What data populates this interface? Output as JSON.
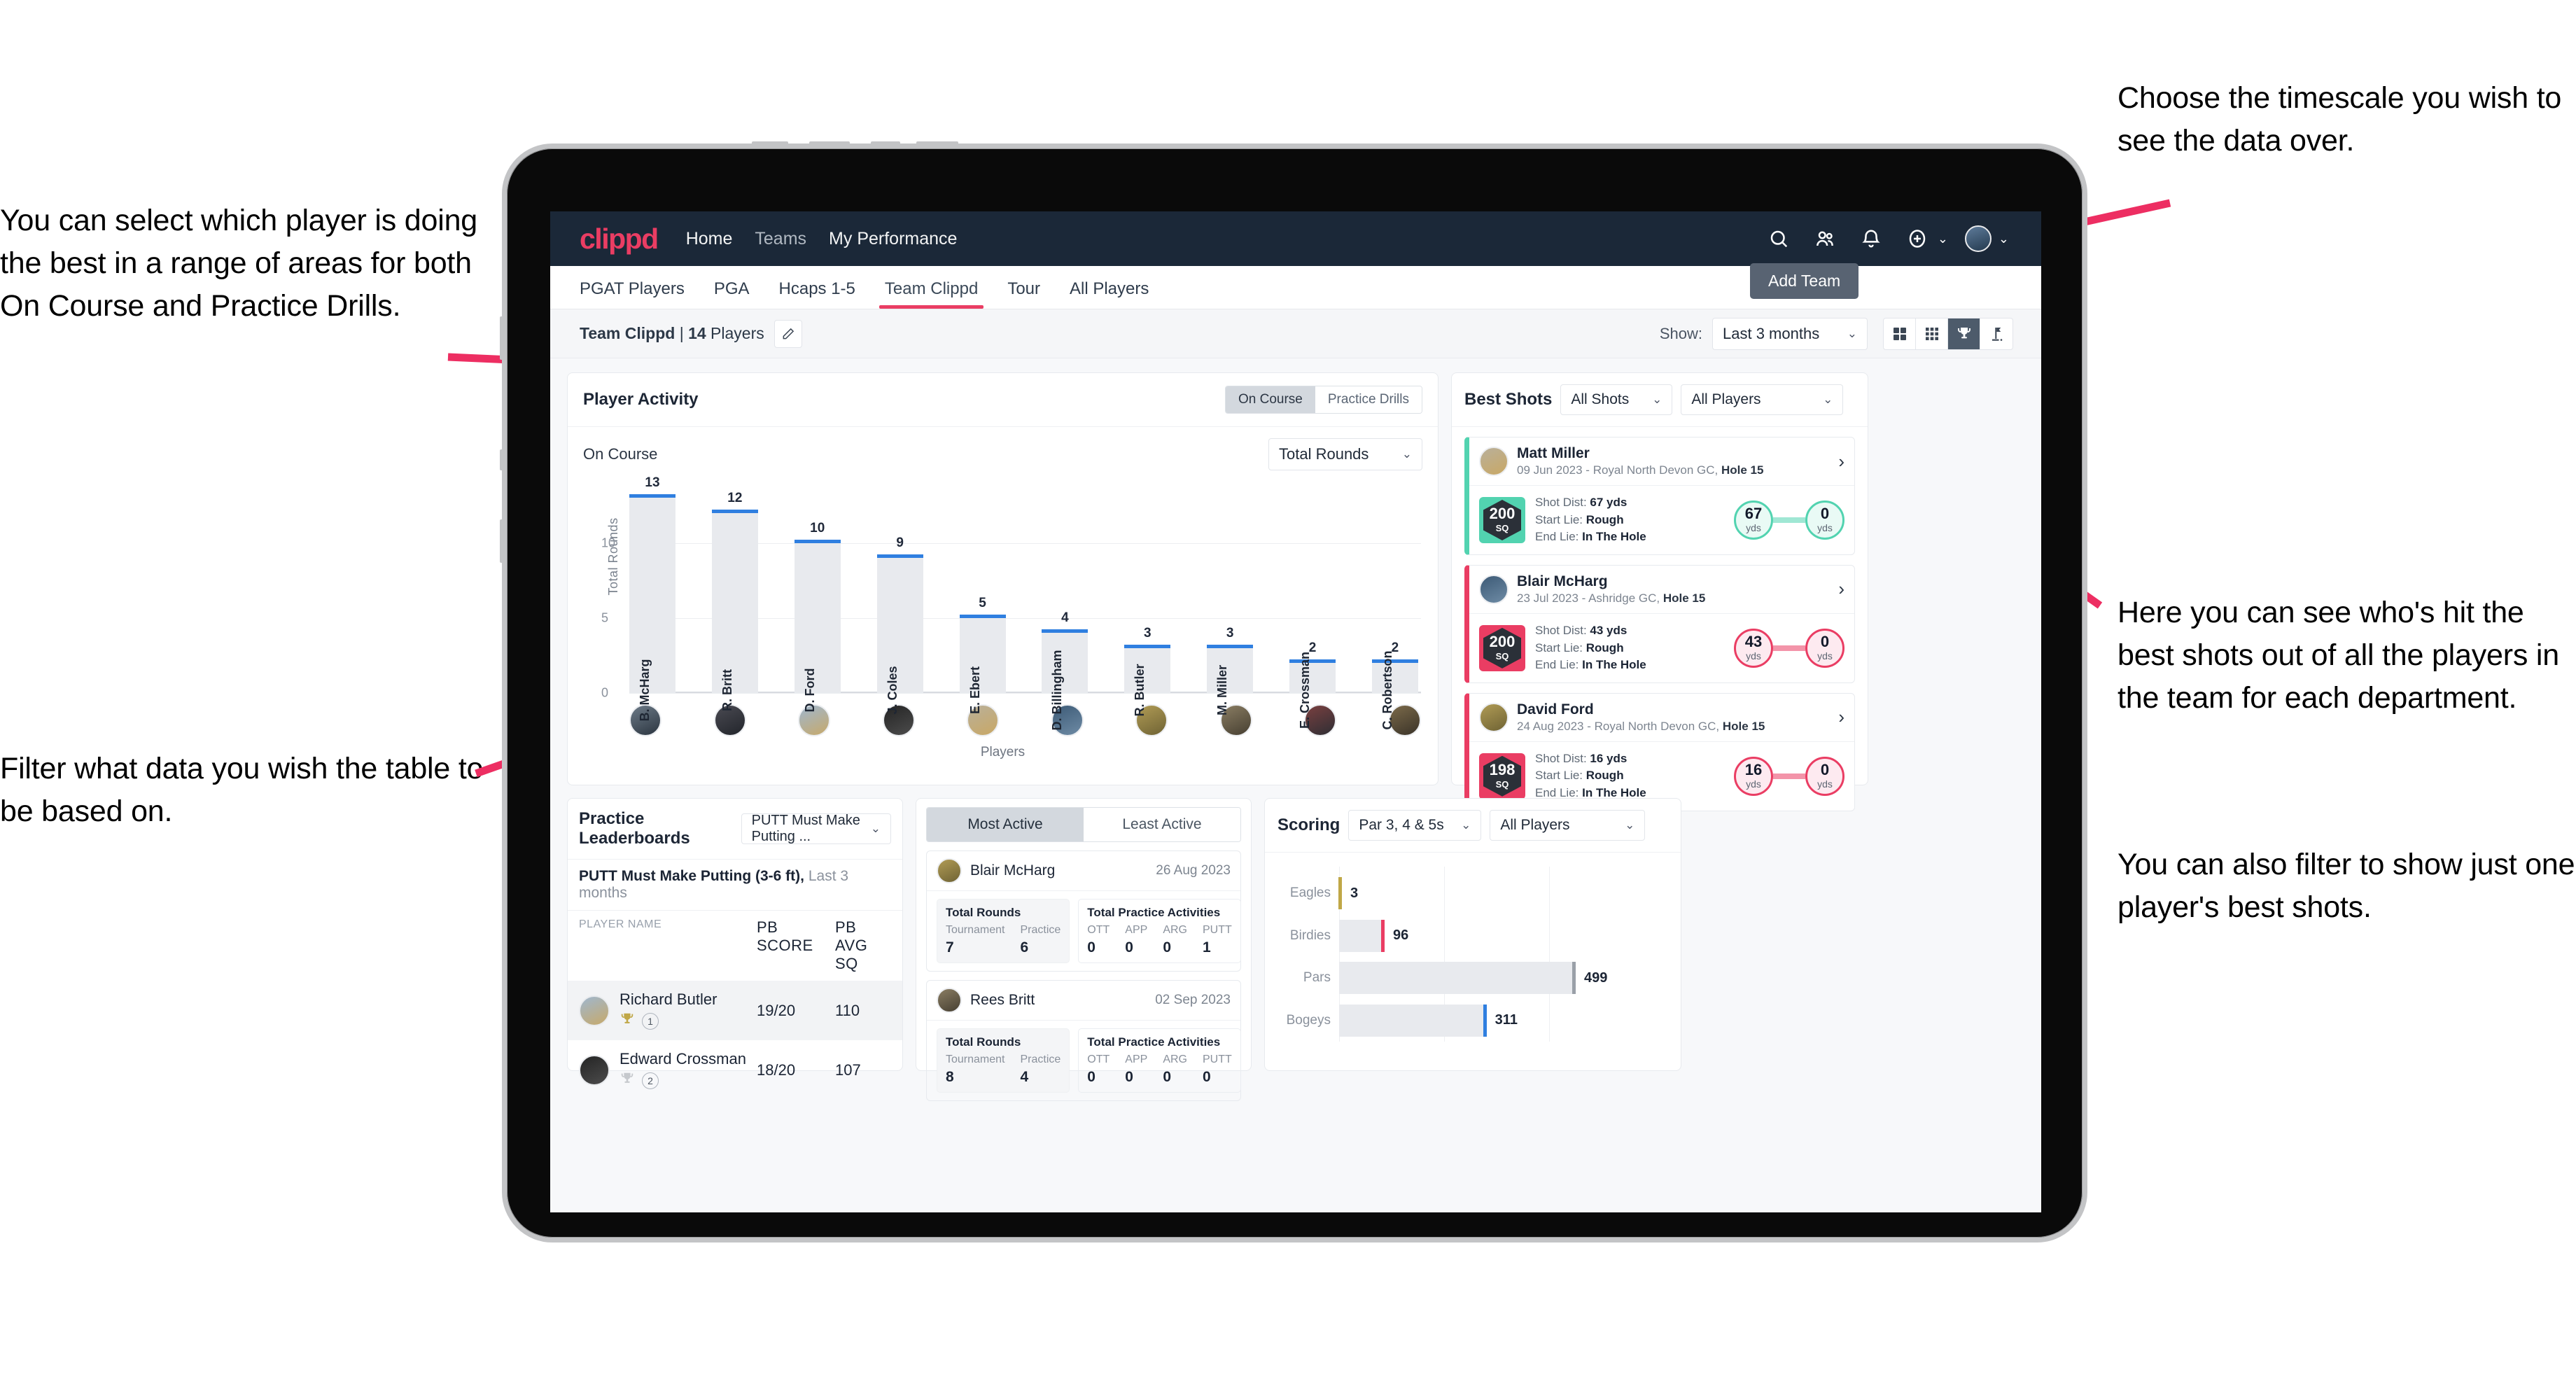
{
  "annotations": {
    "left_top": "You can select which player is doing the best in a range of areas for both On Course and Practice Drills.",
    "left_bottom": "Filter what data you wish the table to be based on.",
    "right_top": "Choose the timescale you wish to see the data over.",
    "right_mid": "Here you can see who's hit the best shots out of all the players in the team for each department.",
    "right_bottom": "You can also filter to show just one player's best shots."
  },
  "topnav": {
    "logo": "clippd",
    "links": [
      "Home",
      "Teams",
      "My Performance"
    ],
    "icons": [
      "search-icon",
      "people-icon",
      "bell-icon",
      "plus-circle-icon",
      "avatar"
    ]
  },
  "tabs": [
    {
      "label": "PGAT Players",
      "active": false
    },
    {
      "label": "PGA",
      "active": false
    },
    {
      "label": "Hcaps 1-5",
      "active": false
    },
    {
      "label": "Team Clippd",
      "active": true
    },
    {
      "label": "Tour",
      "active": false
    },
    {
      "label": "All Players",
      "active": false
    }
  ],
  "tooltip": {
    "add_team": "Add Team"
  },
  "subheader": {
    "team_name": "Team Clippd",
    "separator": " | ",
    "player_count": "14",
    "players_word": " Players",
    "show_label": "Show:",
    "months_value": "Last 3 months",
    "view_modes": [
      "grid-large-icon",
      "grid-small-icon",
      "trophy-icon",
      "flag-icon"
    ],
    "active_view_mode": 2
  },
  "player_activity": {
    "title": "Player Activity",
    "segments": [
      {
        "label": "On Course",
        "active": true
      },
      {
        "label": "Practice Drills",
        "active": false
      }
    ],
    "sub_label": "On Course",
    "metric_value": "Total Rounds"
  },
  "best_shots": {
    "title": "Best Shots",
    "shot_filter": "All Shots",
    "player_filter": "All Players",
    "cards": [
      {
        "name": "Matt Miller",
        "meta_prefix": "09 Jun 2023 - Royal North Devon GC, ",
        "meta_hole": "Hole 15",
        "sq_value": "200",
        "sq_unit": "SQ",
        "accent": "#52d3b0",
        "shot_dist_label": "Shot Dist: ",
        "shot_dist_value": "67 yds",
        "start_lie_label": "Start Lie: ",
        "start_lie_value": "Rough",
        "end_lie_label": "End Lie: ",
        "end_lie_value": "In The Hole",
        "start_num": "67",
        "start_unit": "yds",
        "end_num": "0",
        "end_unit": "yds"
      },
      {
        "name": "Blair McHarg",
        "meta_prefix": "23 Jul 2023 - Ashridge GC, ",
        "meta_hole": "Hole 15",
        "sq_value": "200",
        "sq_unit": "SQ",
        "accent": "#ea3d63",
        "shot_dist_label": "Shot Dist: ",
        "shot_dist_value": "43 yds",
        "start_lie_label": "Start Lie: ",
        "start_lie_value": "Rough",
        "end_lie_label": "End Lie: ",
        "end_lie_value": "In The Hole",
        "start_num": "43",
        "start_unit": "yds",
        "end_num": "0",
        "end_unit": "yds"
      },
      {
        "name": "David Ford",
        "meta_prefix": "24 Aug 2023 - Royal North Devon GC, ",
        "meta_hole": "Hole 15",
        "sq_value": "198",
        "sq_unit": "SQ",
        "accent": "#ea3d63",
        "shot_dist_label": "Shot Dist: ",
        "shot_dist_value": "16 yds",
        "start_lie_label": "Start Lie: ",
        "start_lie_value": "Rough",
        "end_lie_label": "End Lie: ",
        "end_lie_value": "In The Hole",
        "start_num": "16",
        "start_unit": "yds",
        "end_num": "0",
        "end_unit": "yds"
      }
    ]
  },
  "practice_leaderboards": {
    "title": "Practice Leaderboards",
    "drill_value": "PUTT Must Make Putting ...",
    "sub_bold": "PUTT Must Make Putting (3-6 ft),",
    "sub_normal": " Last 3 months",
    "columns": [
      "PLAYER NAME",
      "PB SCORE",
      "PB AVG SQ"
    ],
    "rows": [
      {
        "name": "Richard Butler",
        "pb_score": "19/20",
        "pb_avg_sq": "110",
        "rank": "1",
        "trophy": "#c0a747",
        "highlight": true
      },
      {
        "name": "Edward Crossman",
        "pb_score": "18/20",
        "pb_avg_sq": "107",
        "rank": "2",
        "trophy": "#c6c9cd",
        "highlight": false
      }
    ]
  },
  "activity_panel": {
    "tabs": [
      {
        "label": "Most Active",
        "active": true
      },
      {
        "label": "Least Active",
        "active": false
      }
    ],
    "cards": [
      {
        "name": "Blair McHarg",
        "date": "26 Aug 2023",
        "rounds_title": "Total Rounds",
        "rounds_keys": [
          "Tournament",
          "Practice"
        ],
        "rounds_values": [
          "7",
          "6"
        ],
        "practice_title": "Total Practice Activities",
        "practice_keys": [
          "OTT",
          "APP",
          "ARG",
          "PUTT"
        ],
        "practice_values": [
          "0",
          "0",
          "0",
          "1"
        ]
      },
      {
        "name": "Rees Britt",
        "date": "02 Sep 2023",
        "rounds_title": "Total Rounds",
        "rounds_keys": [
          "Tournament",
          "Practice"
        ],
        "rounds_values": [
          "8",
          "4"
        ],
        "practice_title": "Total Practice Activities",
        "practice_keys": [
          "OTT",
          "APP",
          "ARG",
          "PUTT"
        ],
        "practice_values": [
          "0",
          "0",
          "0",
          "0"
        ]
      }
    ]
  },
  "scoring": {
    "title": "Scoring",
    "par_filter": "Par 3, 4 & 5s",
    "player_filter": "All Players"
  },
  "chart_data": [
    {
      "type": "bar",
      "title": "Player Activity - On Course",
      "xlabel": "Players",
      "ylabel": "Total Rounds",
      "ylim": [
        0,
        14
      ],
      "yticks": [
        0,
        5,
        10
      ],
      "grid": true,
      "bar_color": "#e8eaee",
      "cap_color": "#2f7fe0",
      "categories": [
        "B. McHarg",
        "R. Britt",
        "D. Ford",
        "J. Coles",
        "E. Ebert",
        "D. Billingham",
        "R. Butler",
        "M. Miller",
        "E. Crossman",
        "C. Robertson"
      ],
      "values": [
        13,
        12,
        10,
        9,
        5,
        4,
        3,
        3,
        2,
        2
      ]
    },
    {
      "type": "bar",
      "orientation": "horizontal",
      "title": "Scoring",
      "xlabel": "",
      "ylabel": "",
      "grid": true,
      "categories": [
        "Eagles",
        "Birdies",
        "Pars",
        "Bogeys"
      ],
      "values": [
        3,
        96,
        499,
        311
      ],
      "tip_colors": [
        "#c0a747",
        "#ea3d63",
        "#9aa0a8",
        "#2f7fe0"
      ],
      "xlim": [
        0,
        620
      ]
    }
  ]
}
